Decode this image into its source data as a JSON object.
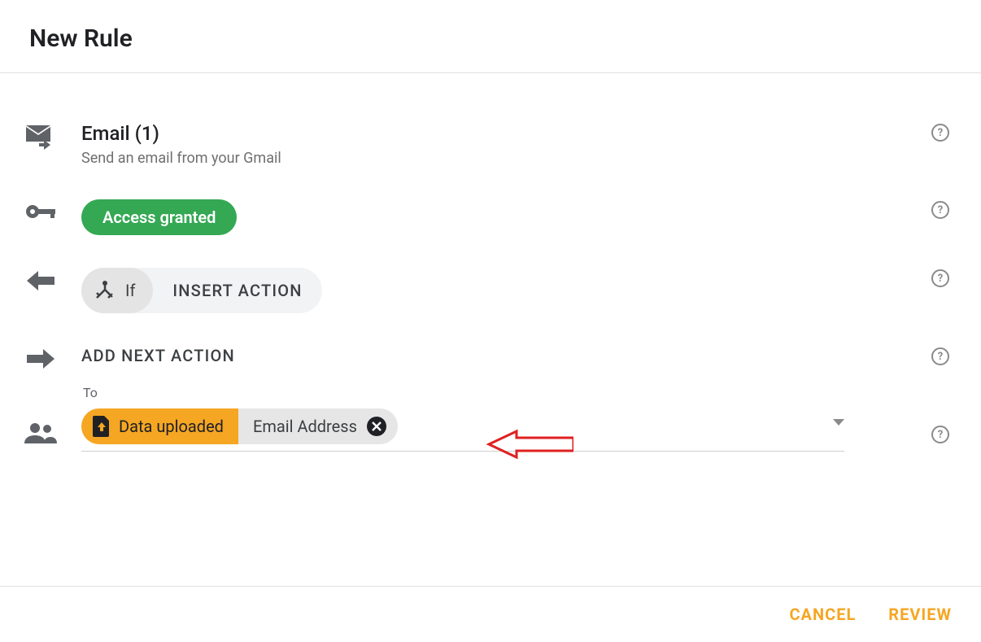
{
  "header": {
    "title": "New Rule"
  },
  "sections": {
    "email": {
      "title": "Email (1)",
      "subtitle": "Send an email from your Gmail"
    },
    "access": {
      "badge": "Access granted"
    },
    "insert": {
      "if_label": "If",
      "action_label": "INSERT ACTION"
    },
    "next": {
      "label": "ADD NEXT ACTION"
    },
    "to": {
      "label": "To",
      "chip_source": "Data uploaded",
      "chip_field": "Email Address"
    }
  },
  "footer": {
    "cancel": "CANCEL",
    "review": "REVIEW"
  },
  "help_glyph": "?"
}
